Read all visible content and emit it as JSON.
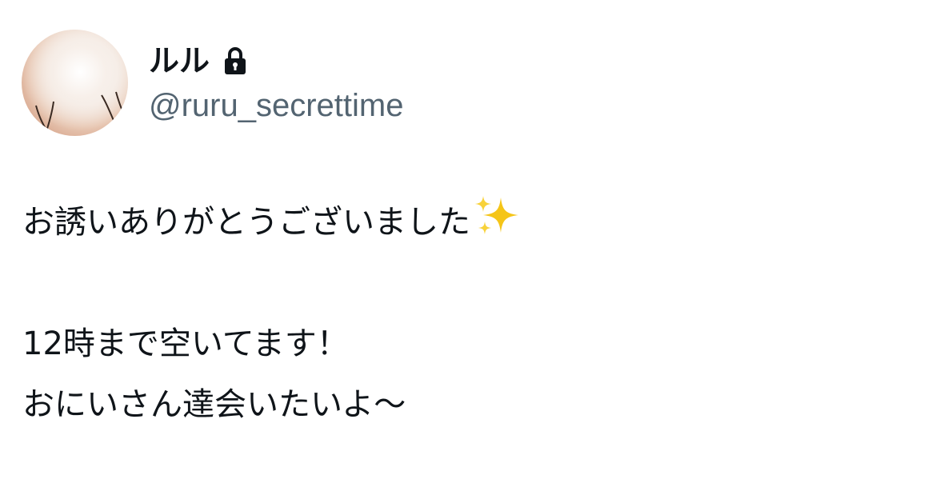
{
  "author": {
    "display_name": "ルル",
    "handle": "@ruru_secrettime",
    "protected_icon": "lock-icon",
    "avatar": "profile-photo"
  },
  "tweet": {
    "lines": [
      "お誘いありがとうございました",
      "",
      "12時まで空いてます！",
      "おにいさん達会いたいよ〜"
    ],
    "emoji": "sparkles-icon"
  },
  "colors": {
    "text_primary": "#0f1419",
    "text_secondary": "#536471",
    "sparkle": "#f5c518"
  }
}
